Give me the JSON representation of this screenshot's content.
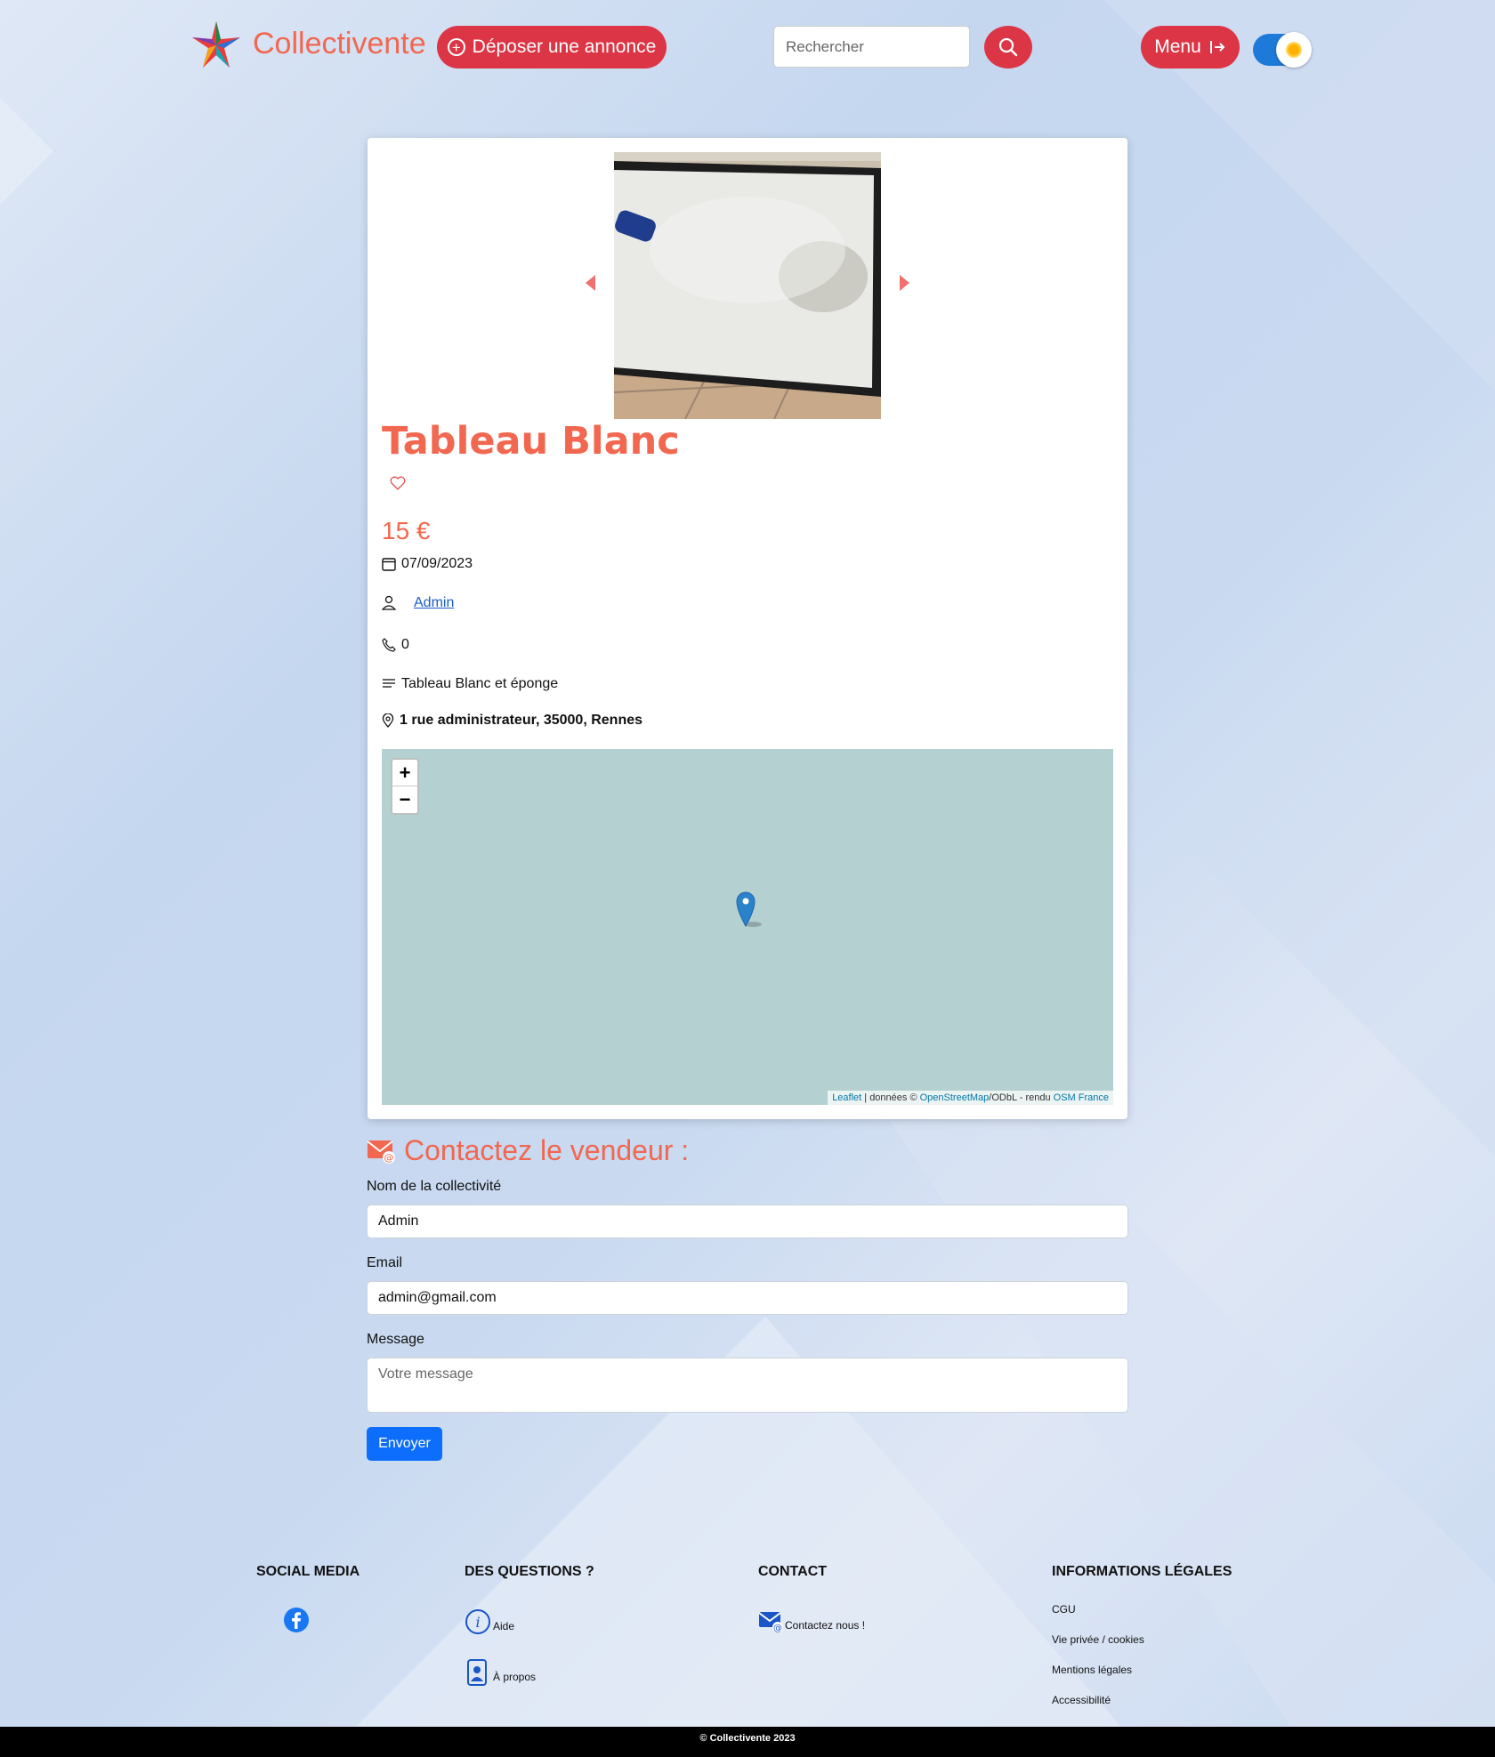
{
  "header": {
    "brand": "Collectivente",
    "post_button": "Déposer une annonce",
    "search_placeholder": "Rechercher",
    "menu_button": "Menu",
    "theme_toggle": "light"
  },
  "listing": {
    "title": "Tableau Blanc",
    "price": "15 €",
    "date": "07/09/2023",
    "seller": "Admin",
    "phone": "0",
    "description": "Tableau Blanc et éponge",
    "address": "1 rue administrateur, 35000, Rennes"
  },
  "map": {
    "zoom_in": "+",
    "zoom_out": "−",
    "attribution_leaflet": "Leaflet",
    "attribution_mid": " | données © ",
    "attribution_osm": "OpenStreetMap",
    "attribution_odbl": "/ODbL - rendu ",
    "attribution_osmfr": "OSM France"
  },
  "contact": {
    "title": "Contactez le vendeur :",
    "name_label": "Nom de la collectivité",
    "name_value": "Admin",
    "email_label": "Email",
    "email_value": "admin@gmail.com",
    "message_label": "Message",
    "message_placeholder": "Votre message",
    "send_button": "Envoyer"
  },
  "footer": {
    "social_title": "SOCIAL MEDIA",
    "questions_title": "DES QUESTIONS ?",
    "help": "Aide",
    "about": "À propos",
    "contact_title": "CONTACT",
    "contact_us": "Contactez nous !",
    "legal_title": "INFORMATIONS LÉGALES",
    "legal_items": [
      "CGU",
      "Vie privée / cookies",
      "Mentions légales",
      "Accessibilité"
    ],
    "copyright": "© Collectivente 2023"
  },
  "colors": {
    "accent": "#f2674f",
    "button_red": "#dc3545",
    "primary_blue": "#0d6efd"
  }
}
